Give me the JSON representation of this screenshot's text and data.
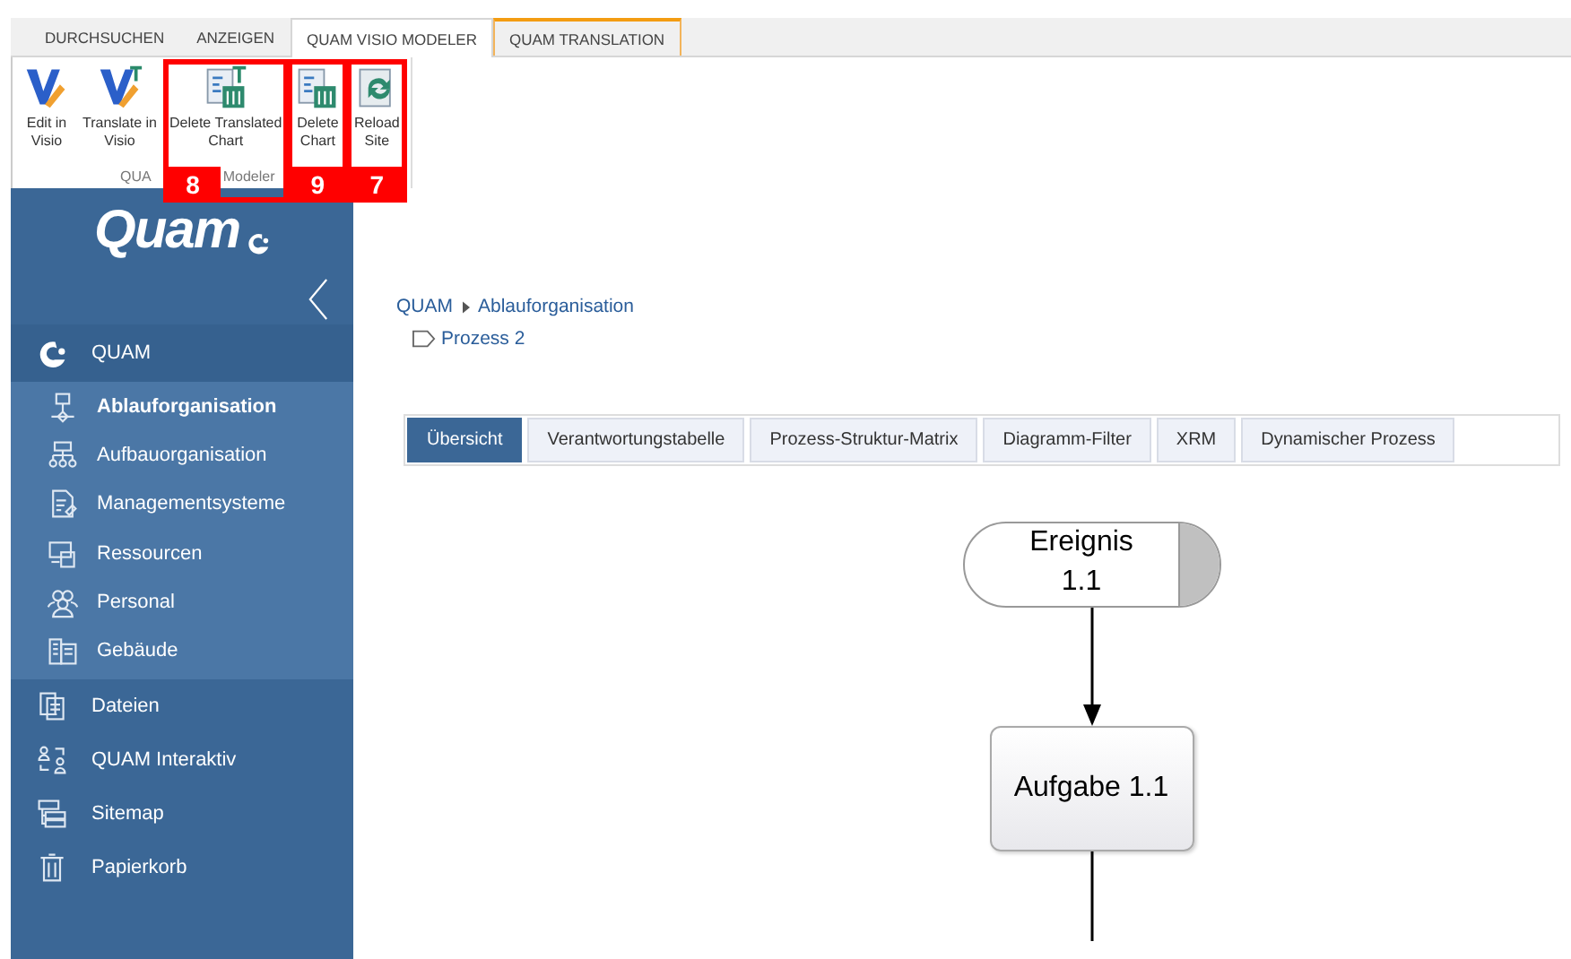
{
  "ribbon": {
    "tabs": [
      {
        "label": "DURCHSUCHEN",
        "selected": false,
        "kind": "normal"
      },
      {
        "label": "ANZEIGEN",
        "selected": false,
        "kind": "normal"
      },
      {
        "label": "QUAM VISIO MODELER",
        "selected": true,
        "kind": "normal"
      },
      {
        "label": "QUAM TRANSLATION",
        "selected": false,
        "kind": "contextual"
      }
    ],
    "buttons": [
      {
        "label": "Edit in\nVisio"
      },
      {
        "label": "Translate in\nVisio"
      },
      {
        "label": "Delete Translated\nChart",
        "callout": "8"
      },
      {
        "label": "Delete\nChart",
        "callout": "9"
      },
      {
        "label": "Reload\nSite",
        "callout": "7"
      }
    ],
    "group_label_parts": [
      "QUA",
      "Modeler"
    ]
  },
  "sidebar": {
    "logo": "Quam",
    "items": [
      {
        "label": "QUAM",
        "expanded": true,
        "children": [
          {
            "label": "Ablauforganisation",
            "selected": true
          },
          {
            "label": "Aufbauorganisation",
            "selected": false
          },
          {
            "label": "Managementsysteme",
            "selected": false
          },
          {
            "label": "Ressourcen",
            "selected": false
          },
          {
            "label": "Personal",
            "selected": false
          },
          {
            "label": "Gebäude",
            "selected": false
          }
        ]
      },
      {
        "label": "Dateien"
      },
      {
        "label": "QUAM Interaktiv"
      },
      {
        "label": "Sitemap"
      },
      {
        "label": "Papierkorb"
      }
    ]
  },
  "breadcrumb": [
    "QUAM",
    "Ablauforganisation"
  ],
  "page": "Prozess 2",
  "tabs": [
    {
      "label": "Übersicht",
      "selected": true
    },
    {
      "label": "Verantwortungstabelle",
      "selected": false
    },
    {
      "label": "Prozess-Struktur-Matrix",
      "selected": false
    },
    {
      "label": "Diagramm-Filter",
      "selected": false
    },
    {
      "label": "XRM",
      "selected": false
    },
    {
      "label": "Dynamischer Prozess",
      "selected": false
    }
  ],
  "diagram": {
    "nodes": [
      {
        "kind": "event",
        "label": "Ereignis\n1.1"
      },
      {
        "kind": "task",
        "label": "Aufgabe 1.1"
      }
    ]
  }
}
